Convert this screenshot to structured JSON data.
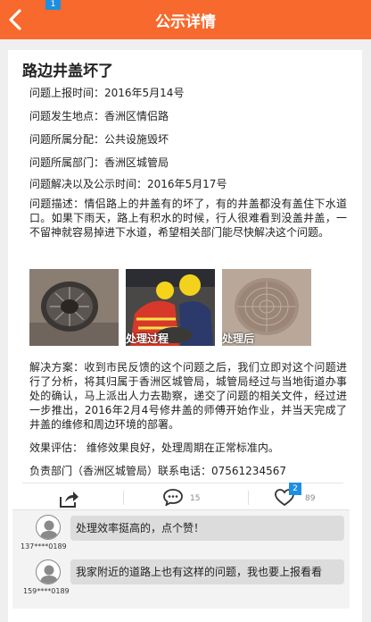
{
  "header": {
    "title": "公示详情",
    "badge": "1",
    "accent": "#f7692c"
  },
  "article": {
    "title": "路边井盖坏了",
    "report_time": "问题上报时间：2016年5月14号",
    "location": "问题发生地点：香洲区情侣路",
    "category": "问题所属分配：公共设施毁坏",
    "department": "问题所属部门：香洲区城管局",
    "resolve_time": "问题解决以及公示时间：2016年5月17号",
    "description": "问题描述：情侣路上的井盖有的坏了，有的井盖都没有盖住下水道口。如果下雨天，路上有积水的时候，行人很难看到没盖井盖，一不留神就容易掉进下水道，希望相关部门能尽快解决这个问题。",
    "photos": [
      {
        "caption": ""
      },
      {
        "caption": "处理过程"
      },
      {
        "caption": "处理后"
      }
    ],
    "solution": "解决方案：收到市民反馈的这个问题之后，我们立即对这个问题进行了分析，将其归属于香洲区城管局，城管局经过与当地街道办事处的确认，马上派出人力去勘察，递交了问题的相关文件，经过进一步推出，2016年2月4号修井盖的师傅开始作业，并当天完成了井盖的维修和周边环境的部署。",
    "evaluation": "效果评估： 维修效果良好，处理周期在正常标准内。",
    "contact": "负责部门（香洲区城管局）联系电话：07561234567"
  },
  "actions": {
    "share_icon": "share-icon",
    "comment_icon": "comment-icon",
    "comment_count": "15",
    "like_icon": "heart-icon",
    "like_badge": "2",
    "like_count": "89",
    "badge_color": "#1e8fe0"
  },
  "comments": [
    {
      "user": "137****0189",
      "text": "处理效率挺高的，点个赞！"
    },
    {
      "user": "159****0189",
      "text": "我家附近的道路上也有这样的问题，我也要上报看看"
    }
  ]
}
